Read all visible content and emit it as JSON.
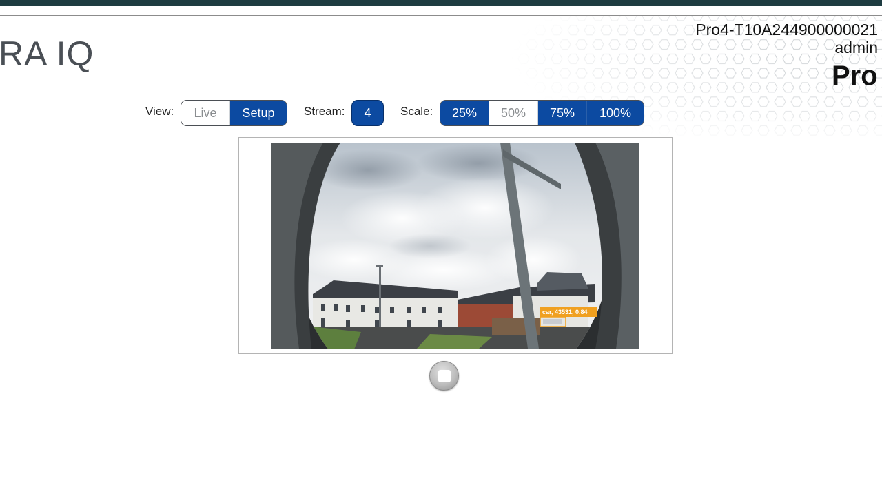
{
  "header": {
    "logo_text": "RA IQ",
    "device_id": "Pro4-T10A244900000021",
    "user": "admin",
    "brand_text": "Pro"
  },
  "controls": {
    "view": {
      "label": "View:",
      "options": [
        "Live",
        "Setup"
      ],
      "selected": "Setup"
    },
    "stream": {
      "label": "Stream:",
      "value": "4"
    },
    "scale": {
      "label": "Scale:",
      "options": [
        "25%",
        "50%",
        "75%",
        "100%"
      ],
      "selected": "50%"
    }
  },
  "video": {
    "detection_label": "car, 43531, 0.84",
    "detection_color": "#f0a020"
  },
  "colors": {
    "accent": "#0c4aa1",
    "top_bar": "#1e3c41"
  },
  "icons": {
    "stop": "stop-icon"
  }
}
